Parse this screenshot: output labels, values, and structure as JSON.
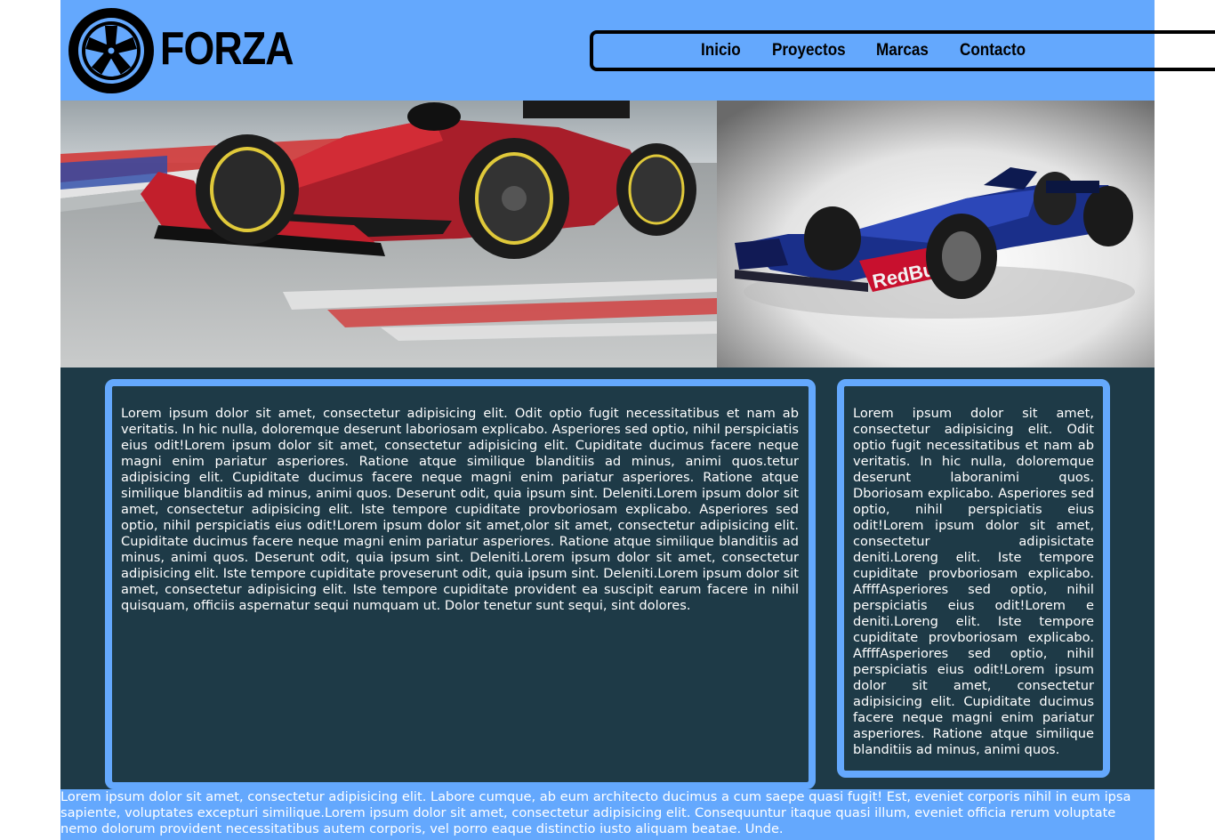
{
  "header": {
    "brand": "FORZA",
    "nav": [
      {
        "label": "Inicio"
      },
      {
        "label": "Proyectos"
      },
      {
        "label": "Marcas"
      },
      {
        "label": "Contacto"
      }
    ]
  },
  "colors": {
    "header_bg": "#64a8fd",
    "main_bg": "#1e3a47",
    "box_border": "#64a8fd",
    "text": "#ffffff"
  },
  "hero": {
    "left_image": "red-f1-car-racing",
    "right_image": "red-bull-f1-car-studio"
  },
  "main": {
    "left_text": "Lorem ipsum dolor sit amet, consectetur adipisicing elit. Odit optio fugit necessitatibus et nam ab veritatis. In hic nulla, doloremque deserunt laboriosam explicabo. Asperiores sed optio, nihil perspiciatis eius odit!Lorem ipsum dolor sit amet, consectetur adipisicing elit. Cupiditate ducimus facere neque magni enim pariatur asperiores. Ratione atque similique blanditiis ad minus, animi quos.tetur adipisicing elit. Cupiditate ducimus facere neque magni enim pariatur asperiores. Ratione atque similique blanditiis ad minus, animi quos. Deserunt odit, quia ipsum sint. Deleniti.Lorem ipsum dolor sit amet, consectetur adipisicing elit. Iste tempore cupiditate provboriosam explicabo. Asperiores sed optio, nihil perspiciatis eius odit!Lorem ipsum dolor sit amet,olor sit amet, consectetur adipisicing elit. Cupiditate ducimus facere neque magni enim pariatur asperiores. Ratione atque similique blanditiis ad minus, animi quos. Deserunt odit, quia ipsum sint. Deleniti.Lorem ipsum dolor sit amet, consectetur adipisicing elit. Iste tempore cupiditate proveserunt odit, quia ipsum sint. Deleniti.Lorem ipsum dolor sit amet, consectetur adipisicing elit. Iste tempore cupiditate provident ea suscipit earum facere in nihil quisquam, officiis aspernatur sequi numquam ut. Dolor tenetur sunt sequi, sint dolores.",
    "right_text": "Lorem ipsum dolor sit amet, consectetur adipisicing elit. Odit optio fugit necessitatibus et nam ab veritatis. In hic nulla, doloremque deserunt laboranimi quos. Dboriosam explicabo. Asperiores sed optio, nihil perspiciatis eius odit!Lorem ipsum dolor sit amet, consectetur adipisictate deniti.Loreng elit. Iste tempore cupiditate provboriosam explicabo. AffffAsperiores sed optio, nihil perspiciatis eius odit!Lorem e deniti.Loreng elit. Iste tempore cupiditate provboriosam explicabo. AffffAsperiores sed optio, nihil perspiciatis eius odit!Lorem ipsum dolor sit amet, consectetur adipisicing elit. Cupiditate ducimus facere neque magni enim pariatur asperiores. Ratione atque similique blanditiis ad minus, animi quos."
  },
  "footer": {
    "text": "Lorem ipsum dolor sit amet, consectetur adipisicing elit. Labore cumque, ab eum architecto ducimus a cum saepe quasi fugit! Est, eveniet corporis nihil in eum ipsa sapiente, voluptates excepturi similique.Lorem ipsum dolor sit amet, consectetur adipisicing elit. Consequuntur itaque quasi illum, eveniet officia rerum voluptate nemo dolorum provident necessitatibus autem corporis, vel porro eaque distinctio iusto aliquam beatae. Unde."
  }
}
